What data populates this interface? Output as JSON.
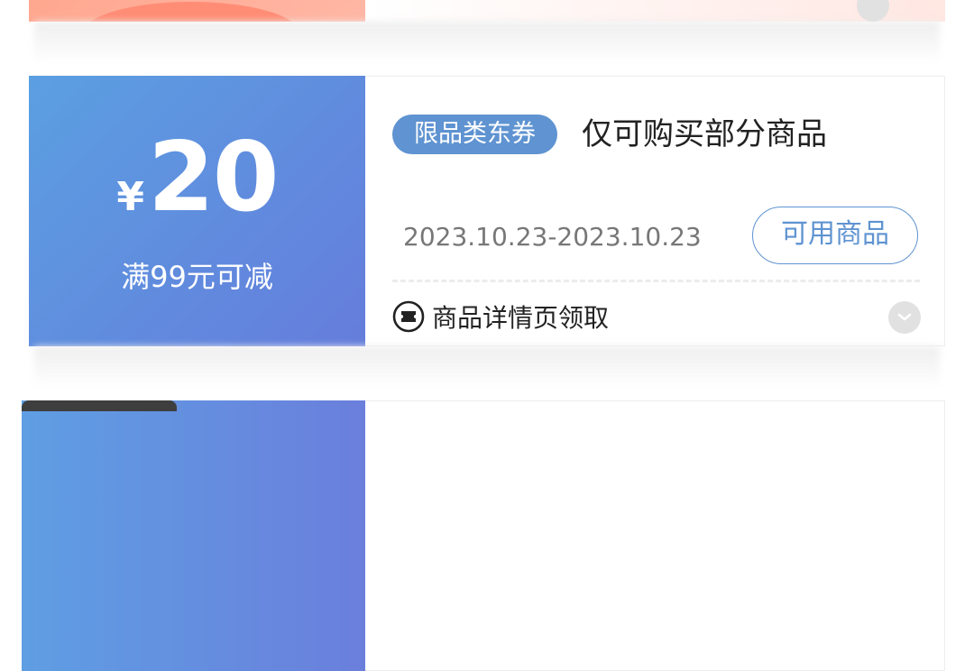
{
  "coupon": {
    "currency": "¥",
    "amount": "20",
    "condition": "满99元可减",
    "tag": "限品类东券",
    "title": "仅可购买部分商品",
    "date_range": "2023.10.23-2023.10.23",
    "use_button": "可用商品",
    "source": "商品详情页领取"
  },
  "colors": {
    "accent_blue": "#5f93d1",
    "gradient_start": "#5b9fe1",
    "gradient_end": "#657ddc",
    "top_coupon_pink": "#ff9c80"
  },
  "icons": {
    "source": "ticket-icon",
    "expand": "chevron-down-icon"
  }
}
